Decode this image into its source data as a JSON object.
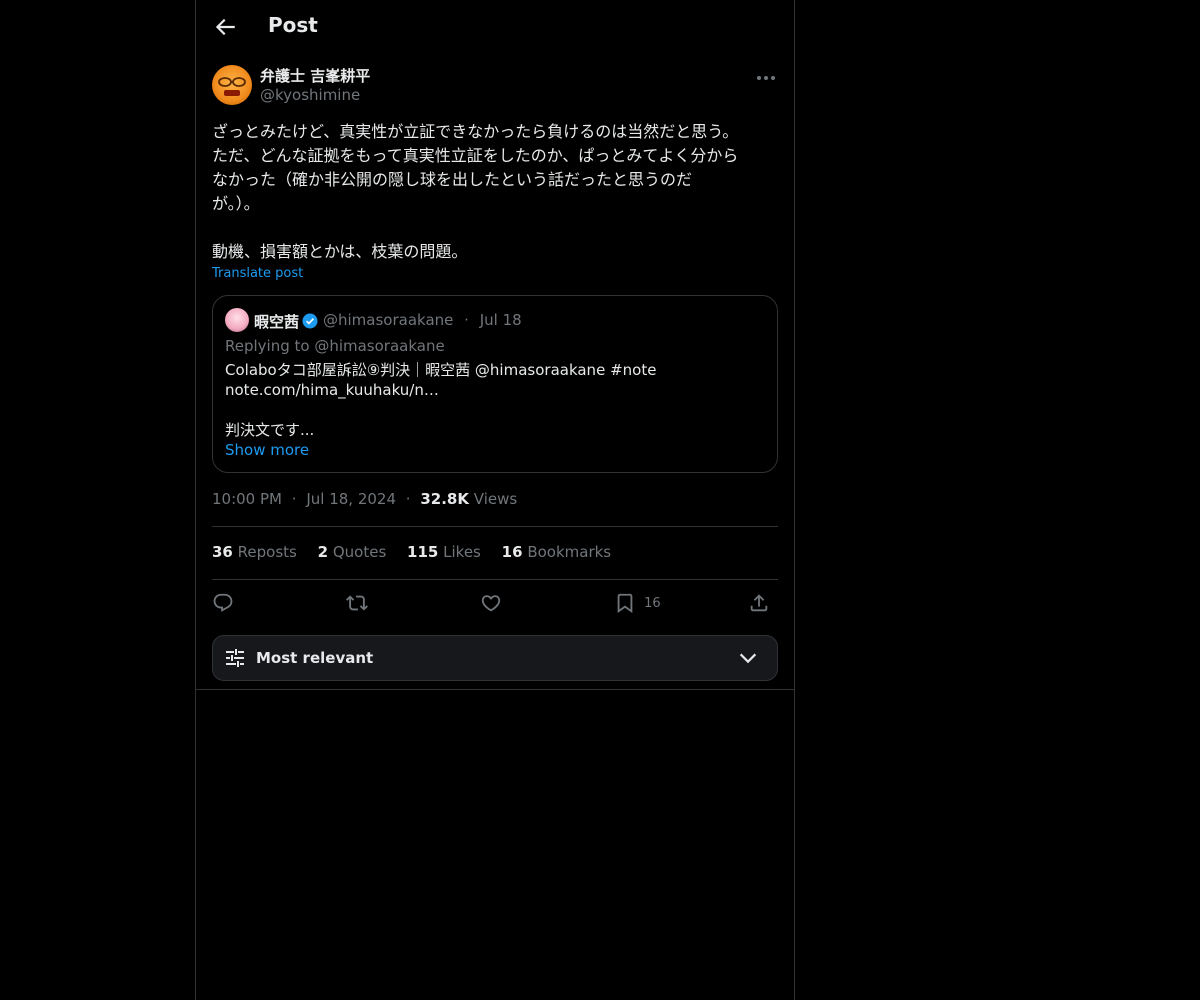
{
  "header": {
    "title": "Post",
    "back_icon": "arrow-left-icon"
  },
  "post": {
    "author_name": "弁護士 吉峯耕平",
    "author_handle": "@kyoshimine",
    "text": "ざっとみたけど、真実性が立証できなかったら負けるのは当然だと思う。\nただ、どんな証拠をもって真実性立証をしたのか、ぱっとみてよく分から\nなかった（確か非公開の隠し球を出したという話だったと思うのだ\nが。）。\n\n動機、損害額とかは、枝葉の問題。",
    "translate_label": "Translate post",
    "time": "10:00 PM",
    "date": "Jul 18, 2024",
    "views_count": "32.8K",
    "views_label": "Views",
    "sep": "·"
  },
  "quote": {
    "name": "暇空茜",
    "handle": "@himasoraakane",
    "sep": "·",
    "date": "Jul 18",
    "replying": "Replying to @himasoraakane",
    "text": "Colaboタコ部屋訴訟⑨判決｜暇空茜 @himasoraakane #note\nnote.com/hima_kuuhaku/n…\n\n判決文です...",
    "show_more": "Show more",
    "verified_color": "#1d9bf0"
  },
  "stats": {
    "reposts_count": "36",
    "reposts_label": "Reposts",
    "quotes_count": "2",
    "quotes_label": "Quotes",
    "likes_count": "115",
    "likes_label": "Likes",
    "bookmarks_count": "16",
    "bookmarks_label": "Bookmarks"
  },
  "actions": {
    "reply_icon": "reply-icon",
    "repost_icon": "repost-icon",
    "like_icon": "heart-icon",
    "bookmark_icon": "bookmark-icon",
    "bookmark_count": "16",
    "share_icon": "share-icon"
  },
  "sort": {
    "label": "Most relevant"
  },
  "colors": {
    "background": "#000000",
    "text": "#e7e9ea",
    "muted": "#71767b",
    "accent": "#1d9bf0",
    "border": "#2f3336"
  }
}
